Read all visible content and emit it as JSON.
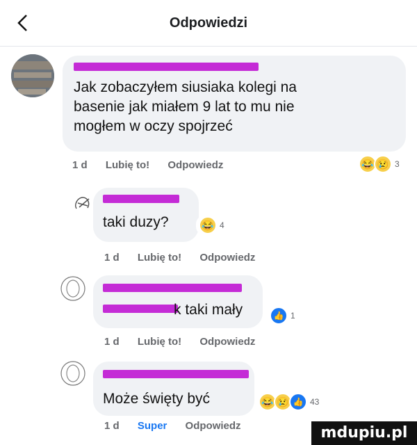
{
  "header": {
    "title": "Odpowiedzi"
  },
  "comments": [
    {
      "text_lines": [
        "Jak zobaczyłem siusiaka kolegi na",
        "basenie jak miałem 9 lat to mu nie",
        "mogłem w oczy spojrzeć"
      ],
      "meta": {
        "time": "1 d",
        "like": "Lubię to!",
        "reply": "Odpowiedz"
      },
      "reactions": {
        "types": [
          "haha",
          "sad"
        ],
        "count": "3"
      }
    },
    {
      "text_lines": [
        "taki duzy?"
      ],
      "meta": {
        "time": "1 d",
        "like": "Lubię to!",
        "reply": "Odpowiedz"
      },
      "reactions": {
        "types": [
          "haha"
        ],
        "count": "4"
      }
    },
    {
      "text_lines": [
        "k taki mały"
      ],
      "meta": {
        "time": "1 d",
        "like": "Lubię to!",
        "reply": "Odpowiedz"
      },
      "reactions": {
        "types": [
          "like"
        ],
        "count": "1"
      }
    },
    {
      "text_lines": [
        "Może święty być"
      ],
      "meta": {
        "time": "1 d",
        "like": "Super",
        "reply": "Odpowiedz"
      },
      "reactions": {
        "types": [
          "haha",
          "sad",
          "like"
        ],
        "count": "43"
      }
    }
  ],
  "watermark": "mdupiu.pl",
  "icons": {
    "back": "chevron-left-icon",
    "haha": "haha-reaction-icon",
    "sad": "sad-reaction-icon",
    "like": "like-reaction-icon",
    "avatar": "person-outline-icon"
  },
  "colors": {
    "bubble": "#f0f2f5",
    "meta": "#65676b",
    "redaction": "#c42bd6",
    "like_active": "#1877f2"
  }
}
